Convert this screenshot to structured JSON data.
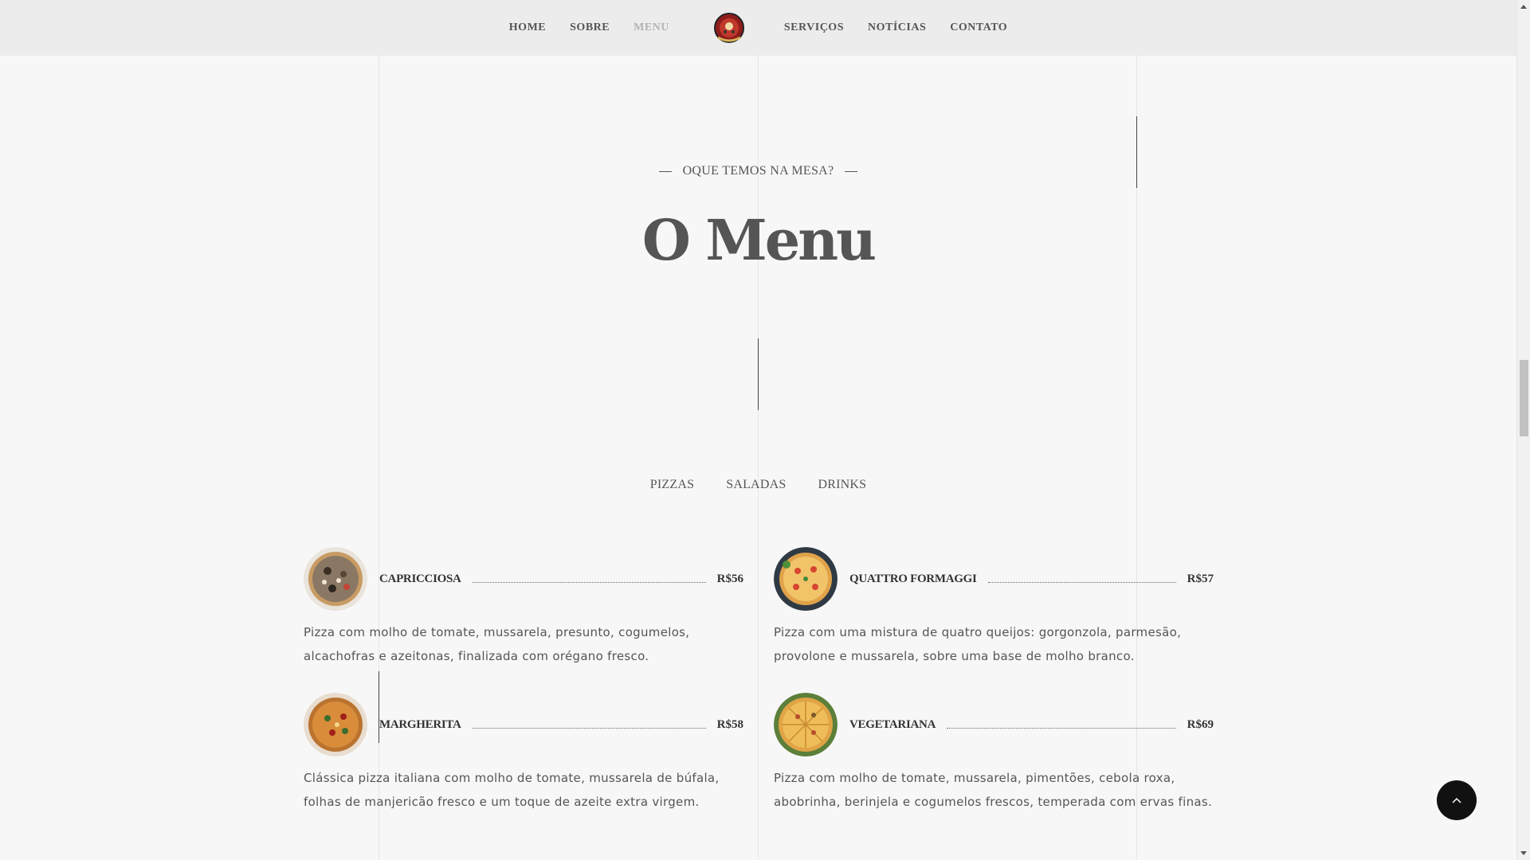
{
  "nav": {
    "left": [
      "HOME",
      "SOBRE",
      "MENU"
    ],
    "right": [
      "SERVIÇOS",
      "NOTÍCIAS",
      "CONTATO"
    ],
    "active": "MENU",
    "logo_icon": "pizza-logo-icon"
  },
  "section": {
    "subtitle": "OQUE TEMOS NA MESA?",
    "title": "O Menu"
  },
  "tabs": [
    "PIZZAS",
    "SALADAS",
    "DRINKS"
  ],
  "items": [
    {
      "name": "CAPRICCIOSA",
      "price": "R$56",
      "description": "Pizza com molho de tomate, mussarela, presunto, cogumelos, alcachofras e azeitonas, finalizada com orégano fresco."
    },
    {
      "name": "QUATTRO FORMAGGI",
      "price": "R$57",
      "description": "Pizza com uma mistura de quatro queijos: gorgonzola, parmesão, provolone e mussarela, sobre uma base de molho branco."
    },
    {
      "name": "MARGHERITA",
      "price": "R$58",
      "description": "Clássica pizza italiana com molho de tomate, mussarela de búfala, folhas de manjericão fresco e um toque de azeite extra virgem."
    },
    {
      "name": "VEGETARIANA",
      "price": "R$69",
      "description": "Pizza com molho de tomate, mussarela, pimentões, cebola roxa, abobrinha, berinjela e cogumelos frescos, temperada com ervas finas."
    }
  ],
  "colors": {
    "background": "#f7f7f7",
    "navbar": "#ececec",
    "text": "#555555",
    "active_nav": "#b3b3b3",
    "to_top_button": "#111111"
  },
  "icons": {
    "to_top": "chevron-up-icon"
  }
}
